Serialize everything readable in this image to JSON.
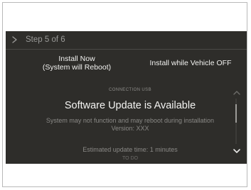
{
  "header": {
    "back_icon": "chevron-right-icon",
    "step_label": "Step 5 of 6"
  },
  "options": {
    "install_now_line1": "Install Now",
    "install_now_line2": "(System will Reboot)",
    "install_off": "Install while Vehicle OFF"
  },
  "content": {
    "caption": "CONNECTION USB",
    "title": "Software Update is Available",
    "desc_line1": "System may not function and may reboot during installation",
    "desc_line2": "Version: XXX",
    "estimate": "Estimated update time: 1 minutes",
    "estimate_sub": "TO DO"
  },
  "scroll": {
    "up_icon": "chevron-up-icon",
    "down_icon": "chevron-down-icon"
  },
  "colors": {
    "screen_bg": "#2e2d2a",
    "text_primary": "#f4f4f2",
    "text_secondary": "#8a8986"
  }
}
